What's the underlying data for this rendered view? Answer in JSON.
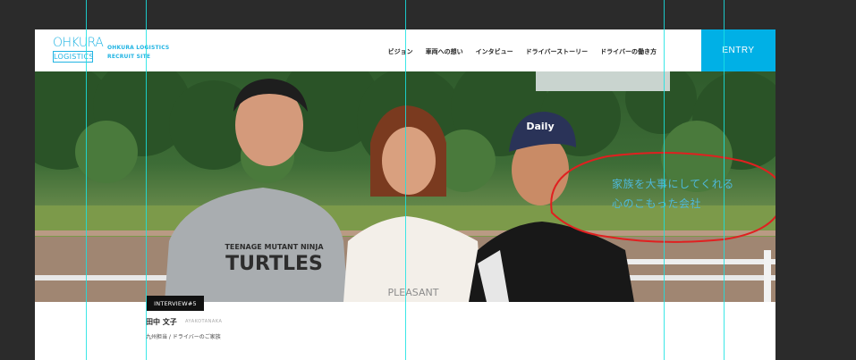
{
  "header": {
    "logo_top": "OHKURA",
    "logo_bottom": "LOGISTICS",
    "site_tag_line1": "OHKURA LOGISTICS",
    "site_tag_line2": "RECRUIT SITE",
    "nav": [
      {
        "label": "ビジョン"
      },
      {
        "label": "車両への想い"
      },
      {
        "label": "インタビュー"
      },
      {
        "label": "ドライバーストーリー"
      },
      {
        "label": "ドライバーの働き方"
      }
    ],
    "entry_label": "ENTRY"
  },
  "hero": {
    "shirt_line1": "TEENAGE MUTANT NINJA",
    "shirt_line2": "TURTLES",
    "cap_text": "Daily",
    "mid_shirt_text": "PLEASANT",
    "caption_line1": "家族を大事にしてくれる",
    "caption_line2": "心のこもった会社",
    "annotation_color": "#e02020"
  },
  "interview": {
    "tag": "INTERVIEW#5",
    "name": "田中 文子",
    "roman": "AYAKOTANAKA",
    "role": "九州担当 / ドライバーのご家族"
  },
  "colors": {
    "accent": "#00b0e6",
    "guide": "#19e3e3"
  }
}
